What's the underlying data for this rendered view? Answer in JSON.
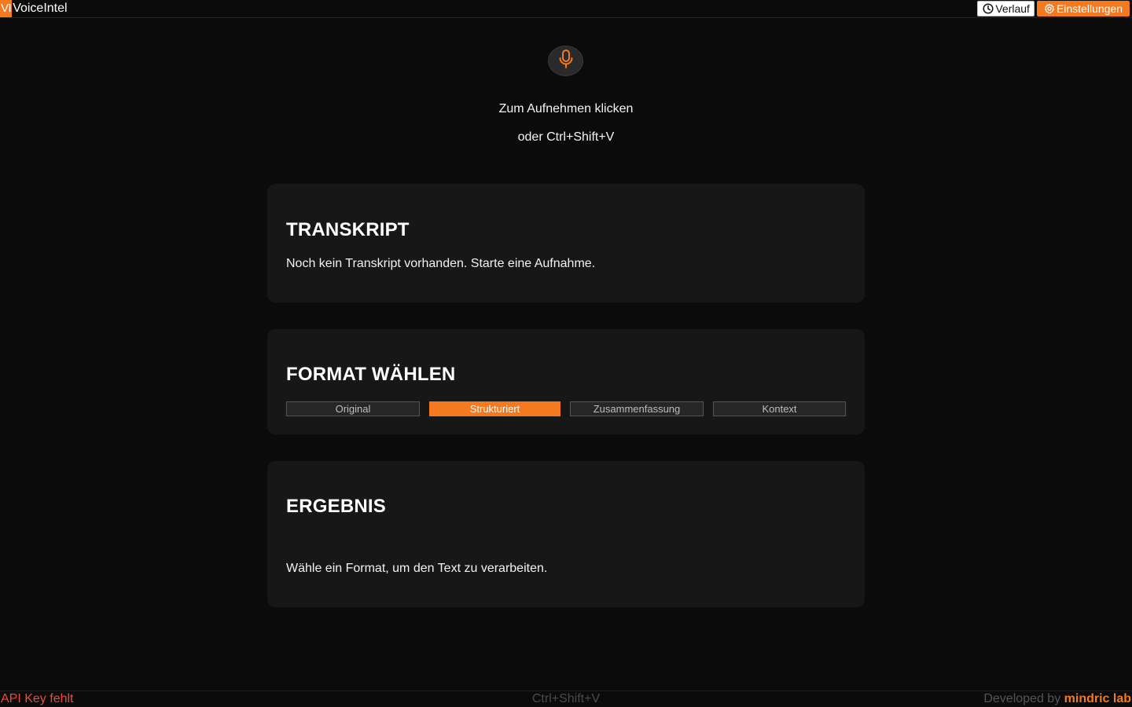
{
  "app": {
    "logo_text": "VI",
    "name": "VoiceIntel"
  },
  "header": {
    "history_label": "Verlauf",
    "settings_label": "Einstellungen"
  },
  "recorder": {
    "hint_line1": "Zum Aufnehmen klicken",
    "hint_line2": "oder Ctrl+Shift+V"
  },
  "transcript": {
    "title": "TRANSKRIPT",
    "empty_text": "Noch kein Transkript vorhanden. Starte eine Aufnahme."
  },
  "format": {
    "title": "FORMAT WÄHLEN",
    "options": [
      "Original",
      "Strukturiert",
      "Zusammenfassung",
      "Kontext"
    ],
    "selected": "Strukturiert"
  },
  "result": {
    "title": "ERGEBNIS",
    "empty_text": "Wähle ein Format, um den Text zu verarbeiten."
  },
  "status": {
    "error": "API Key fehlt",
    "shortcut": "Ctrl+Shift+V",
    "credit_prefix": "Developed by",
    "credit_brand": "mindric lab"
  },
  "colors": {
    "accent": "#f57a1f",
    "background": "#0b0b0b",
    "card": "#171717",
    "error": "#ef4a3b"
  },
  "icons": {
    "history": "clock-icon",
    "settings": "gear-icon",
    "record": "microphone-icon"
  }
}
